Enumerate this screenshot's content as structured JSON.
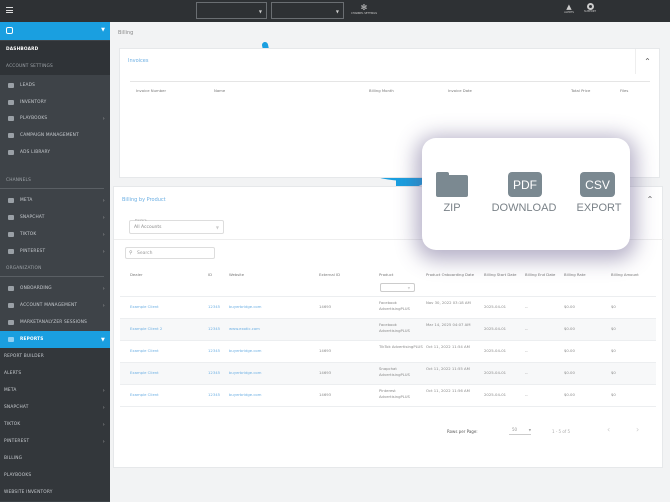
{
  "topbar": {
    "channel_settings": "CHANNEL SETTINGS",
    "alerts": "ALERTS",
    "support": "SUPPORT"
  },
  "sidebar": {
    "dashboard": "DASHBOARD",
    "account_settings": "ACCOUNT SETTINGS",
    "account_items": [
      {
        "label": "LEADS",
        "icon": "filter-icon"
      },
      {
        "label": "INVENTORY",
        "icon": "car-icon"
      },
      {
        "label": "PLAYBOOKS",
        "icon": "playbook-icon",
        "chevron": true
      },
      {
        "label": "CAMPAIGN MANAGEMENT",
        "icon": "megaphone-icon"
      },
      {
        "label": "ADS LIBRARY",
        "icon": "library-icon"
      }
    ],
    "channels": "CHANNELS",
    "channel_items": [
      {
        "label": "META",
        "icon": "meta-icon"
      },
      {
        "label": "SNAPCHAT",
        "icon": "snapchat-icon"
      },
      {
        "label": "TIKTOK",
        "icon": "tiktok-icon"
      },
      {
        "label": "PINTEREST",
        "icon": "pinterest-icon"
      }
    ],
    "organization": "ORGANIZATION",
    "org_items": [
      {
        "label": "ONBOARDING",
        "icon": "onboarding-icon"
      },
      {
        "label": "ACCOUNT MANAGEMENT",
        "icon": "building-icon"
      },
      {
        "label": "MARKETANALYZER SESSIONS",
        "icon": "clipboard-icon"
      }
    ],
    "reports": "REPORTS",
    "report_items": [
      {
        "label": "REPORT BUILDER"
      },
      {
        "label": "ALERTS"
      },
      {
        "label": "META",
        "chevron": true
      },
      {
        "label": "SNAPCHAT",
        "chevron": true
      },
      {
        "label": "TIKTOK",
        "chevron": true
      },
      {
        "label": "PINTEREST",
        "chevron": true
      },
      {
        "label": "BILLING"
      },
      {
        "label": "PLAYBOOKS"
      },
      {
        "label": "WEBSITE INVENTORY"
      }
    ]
  },
  "breadcrumb": "Billing",
  "invoices": {
    "title": "Invoices",
    "columns": [
      "Invoice Number",
      "Name",
      "Billing Month",
      "Invoice Date",
      "Total Price",
      "Files"
    ]
  },
  "billing": {
    "title": "Billing by Product",
    "filter_label": "Dealers",
    "filter_value": "All Accounts",
    "search_placeholder": "Search",
    "columns": [
      "Dealer",
      "ID",
      "Website",
      "External ID",
      "Product",
      "Product Onboarding Date",
      "Billing Start Date",
      "Billing End Date",
      "Billing Rate",
      "Billing Amount"
    ],
    "rows": [
      [
        "Example Client",
        "12345",
        "buyerbridge.com",
        "14693",
        "Facebook AdvertisingPLUS",
        "Nov 30, 2022 03:18 AM",
        "2025-04-01",
        "--",
        "$0.00",
        "$0"
      ],
      [
        "Example Client 2",
        "12345",
        "www.exotic.com",
        "",
        "Facebook AdvertisingPLUS",
        "Mar 14, 2025 04:07 AM",
        "2025-04-01",
        "--",
        "$0.00",
        "$0"
      ],
      [
        "Example Client",
        "12345",
        "buyerbridge.com",
        "14693",
        "TikTok AdvertisingPLUS",
        "Oct 11, 2022 11:54 AM",
        "2025-04-01",
        "--",
        "$0.00",
        "$0"
      ],
      [
        "Example Client",
        "12345",
        "buyerbridge.com",
        "14693",
        "Snapchat AdvertisingPLUS",
        "Oct 11, 2022 11:55 AM",
        "2025-04-01",
        "--",
        "$0.00",
        "$0"
      ],
      [
        "Example Client",
        "12345",
        "buyerbridge.com",
        "14693",
        "Pinterest AdvertisingPLUS",
        "Oct 11, 2022 11:56 AM",
        "2025-04-01",
        "--",
        "$0.00",
        "$0"
      ]
    ],
    "rows_per_page_label": "Rows per Page:",
    "rows_per_page": "50",
    "range": "1 - 5 of 5"
  },
  "overlay": {
    "zip": "ZIP",
    "pdf_badge": "PDF",
    "download": "DOWNLOAD",
    "csv_badge": "CSV",
    "export": "EXPORT"
  },
  "colors": {
    "accent": "#1a9fe0",
    "sidebar": "#3e4348",
    "topbar": "#2e3134",
    "icon_gray": "#7b8991"
  }
}
